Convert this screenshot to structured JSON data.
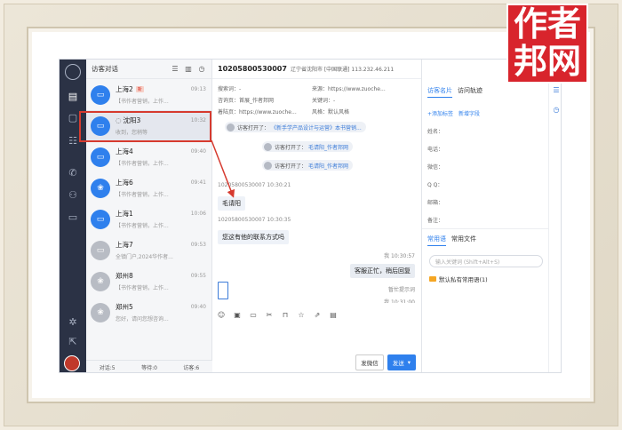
{
  "watermark": {
    "line1": "作者",
    "line2": "邦网"
  },
  "conversations": {
    "title": "访客对话",
    "items": [
      {
        "name": "上海2",
        "badge": "新",
        "time": "09:13",
        "preview": "【书作者营销，上作...",
        "avatar": "blue",
        "icon": "monitor"
      },
      {
        "name": "沈阳3",
        "time": "10:32",
        "preview": "收到，您稍等",
        "avatar": "blue",
        "icon": "monitor",
        "selected": true
      },
      {
        "name": "上海4",
        "time": "09:40",
        "preview": "【书作者营销，上作...",
        "avatar": "blue",
        "icon": "monitor"
      },
      {
        "name": "上海6",
        "time": "09:41",
        "preview": "【书作者营销，上作...",
        "avatar": "blue",
        "icon": "paw"
      },
      {
        "name": "上海1",
        "time": "10:06",
        "preview": "【书作者营销，上作...",
        "avatar": "blue",
        "icon": "monitor"
      },
      {
        "name": "上海7",
        "time": "09:53",
        "preview": "全镇门户,2024华作者...",
        "avatar": "grey",
        "icon": "monitor"
      },
      {
        "name": "郑州8",
        "time": "09:55",
        "preview": "【书作者营销，上作...",
        "avatar": "grey",
        "icon": "paw"
      },
      {
        "name": "郑州5",
        "time": "09:40",
        "preview": "您好，请问您想咨询...",
        "avatar": "grey",
        "icon": "paw"
      }
    ],
    "footer": {
      "dialog": "对话:5",
      "waiting": "等待:0",
      "visitors": "访客:6"
    }
  },
  "chat": {
    "visitor_id": "10205800530007",
    "location": "辽宁省沈阳市 [中国联通] 113.232.46.211",
    "info": [
      [
        "搜索词：-",
        "来源：https://www.zuoche..."
      ],
      [
        "咨询页：首展_作者邦网",
        "关键词：-"
      ],
      [
        "着陆页：https://www.zuoche...",
        "风格：默认风格"
      ]
    ],
    "events": [
      {
        "text": "访客打开了：",
        "link": "《新手学产品设计与运营》本书营销..."
      },
      {
        "text": "访客打开了：",
        "link": "毛请阳_作者邦网"
      },
      {
        "text": "访客打开了：",
        "link": "毛请阳_作者邦网"
      }
    ],
    "messages": [
      {
        "meta": "10205800530007 10:30:21",
        "text": "毛请阳"
      },
      {
        "meta": "10205800530007 10:30:35",
        "text": "您这有他的联系方式吗"
      }
    ],
    "reply": {
      "meta": "我 10:30:57",
      "text": "客服正忙，稍后回复"
    },
    "hint": "暂忙提示词",
    "cut_time": "我 10:31:00",
    "buttons": {
      "wechat": "发微信",
      "send": "发送"
    }
  },
  "side": {
    "tabs": [
      "访客名片",
      "访问轨迹"
    ],
    "links": [
      "+添加标签",
      "新增字段"
    ],
    "fields": [
      "姓名：",
      "电话：",
      "微信：",
      "Q Q：",
      "邮箱：",
      "备注："
    ],
    "tabs2": [
      "常用语",
      "常用文件"
    ],
    "keyword_placeholder": "输入关键词 (Shift+Alt+S)",
    "folder": "默认私有常用语(1)"
  }
}
